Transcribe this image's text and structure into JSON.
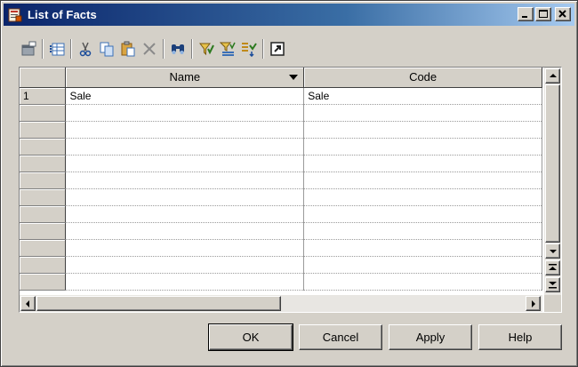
{
  "window": {
    "title": "List of Facts",
    "minimize_glyph": "_",
    "maximize_glyph": "□",
    "close_glyph": "×"
  },
  "toolbar": {
    "buttons": [
      {
        "icon": "properties-icon"
      },
      {
        "icon": "add-rows-icon"
      },
      {
        "icon": "cut-icon"
      },
      {
        "icon": "copy-icon"
      },
      {
        "icon": "paste-icon"
      },
      {
        "icon": "delete-icon"
      },
      {
        "icon": "find-icon"
      },
      {
        "icon": "filter-icon"
      },
      {
        "icon": "customize-columns-icon"
      },
      {
        "icon": "sort-icon"
      },
      {
        "icon": "open-icon"
      }
    ]
  },
  "grid": {
    "columns": [
      {
        "label": "Name",
        "sorted": true
      },
      {
        "label": "Code",
        "sorted": false
      }
    ],
    "rows": [
      {
        "num": "1",
        "name": "Sale",
        "code": "Sale"
      }
    ]
  },
  "buttons": {
    "ok": "OK",
    "cancel": "Cancel",
    "apply": "Apply",
    "help": "Help"
  },
  "colors": {
    "title_start": "#0a246a",
    "title_end": "#a6caf0",
    "face": "#d4d0c8"
  }
}
